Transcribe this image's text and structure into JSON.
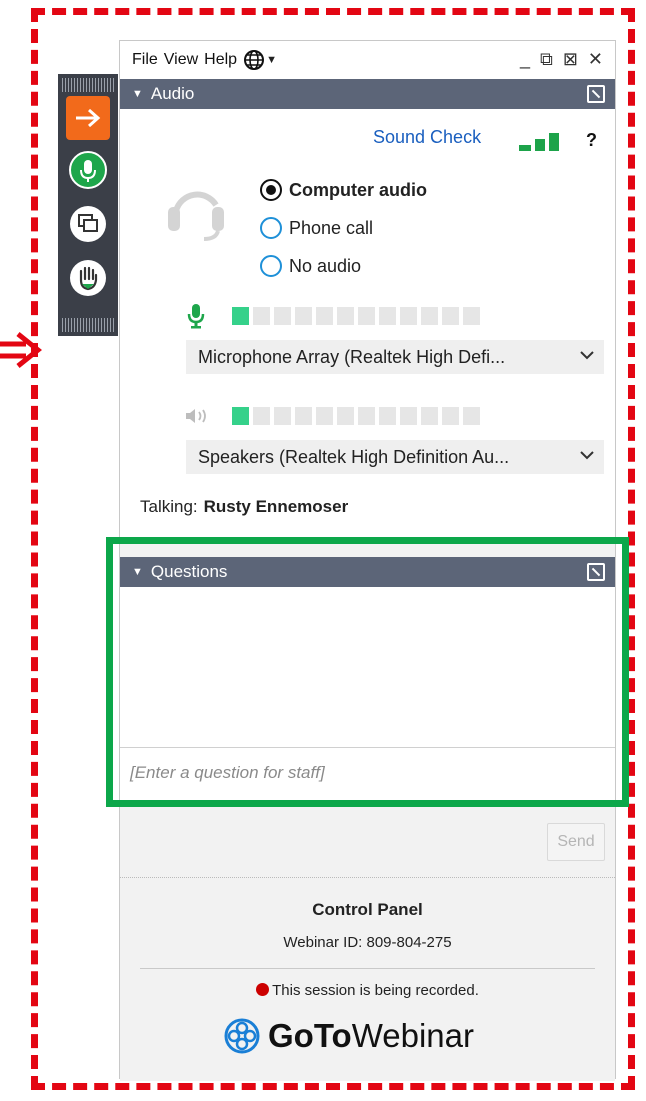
{
  "menubar": {
    "file": "File",
    "view": "View",
    "help": "Help"
  },
  "audio": {
    "section_title": "Audio",
    "sound_check": "Sound Check",
    "help": "?",
    "options": [
      {
        "label": "Computer audio",
        "selected": true
      },
      {
        "label": "Phone call",
        "selected": false
      },
      {
        "label": "No audio",
        "selected": false
      }
    ],
    "microphone": "Microphone Array (Realtek High Defi...",
    "speakers": "Speakers (Realtek High Definition Au...",
    "mic_level_segments_on": 1,
    "speaker_level_segments_on": 1,
    "level_segments_total": 12,
    "talking_label": "Talking:",
    "talking_name": "Rusty Ennemoser"
  },
  "questions": {
    "section_title": "Questions",
    "placeholder": "[Enter a question for staff]",
    "send": "Send"
  },
  "footer": {
    "title": "Control Panel",
    "webinar_id": "Webinar ID: 809-804-275",
    "recording": "This session is being recorded.",
    "brand_goto": "GoTo",
    "brand_webinar": "Webinar"
  },
  "colors": {
    "annotation_red": "#e30613",
    "annotation_green": "#0ca74a",
    "header_bg": "#5c6578",
    "link_blue": "#1a5fbf",
    "meter_on": "#35d18a"
  },
  "icons": [
    "arrow-right-icon",
    "microphone-icon",
    "screen-share-icon",
    "raise-hand-icon",
    "globe-icon",
    "headset-icon",
    "speaker-icon",
    "chevron-down-icon",
    "popout-icon",
    "minimize-icon",
    "restore-icon",
    "close-icon",
    "gotowebinar-logo-icon",
    "record-dot-icon"
  ]
}
